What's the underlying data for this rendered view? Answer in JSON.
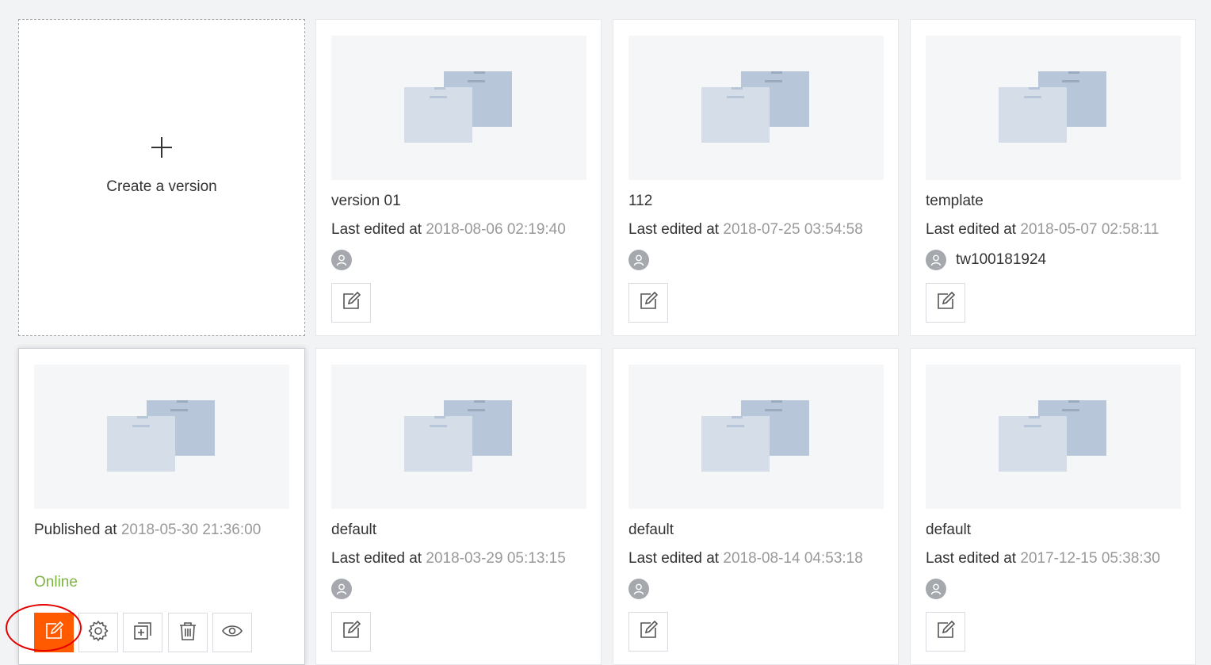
{
  "create_card": {
    "label": "Create a version"
  },
  "online_card": {
    "published_label": "Published at",
    "published_at": "2018-05-30 21:36:00",
    "status": "Online",
    "status_color": "#7cb342",
    "actions": [
      {
        "name": "edit-button",
        "icon": "edit-icon",
        "primary": true
      },
      {
        "name": "settings-button",
        "icon": "gear-icon"
      },
      {
        "name": "duplicate-button",
        "icon": "duplicate-icon"
      },
      {
        "name": "delete-button",
        "icon": "trash-icon"
      },
      {
        "name": "preview-button",
        "icon": "eye-icon"
      }
    ],
    "accent_color": "#ff5a00",
    "highlight_color": "#e60000"
  },
  "edited_label": "Last edited at",
  "versions": [
    {
      "title": "version 01",
      "edited_at": "2018-08-06 02:19:40",
      "user": ""
    },
    {
      "title": "112",
      "edited_at": "2018-07-25 03:54:58",
      "user": ""
    },
    {
      "title": "template",
      "edited_at": "2018-05-07 02:58:11",
      "user": "tw100181924"
    },
    {
      "title": "default",
      "edited_at": "2018-03-29 05:13:15",
      "user": ""
    },
    {
      "title": "default",
      "edited_at": "2018-08-14 04:53:18",
      "user": ""
    },
    {
      "title": "default",
      "edited_at": "2017-12-15 05:38:30",
      "user": ""
    }
  ]
}
